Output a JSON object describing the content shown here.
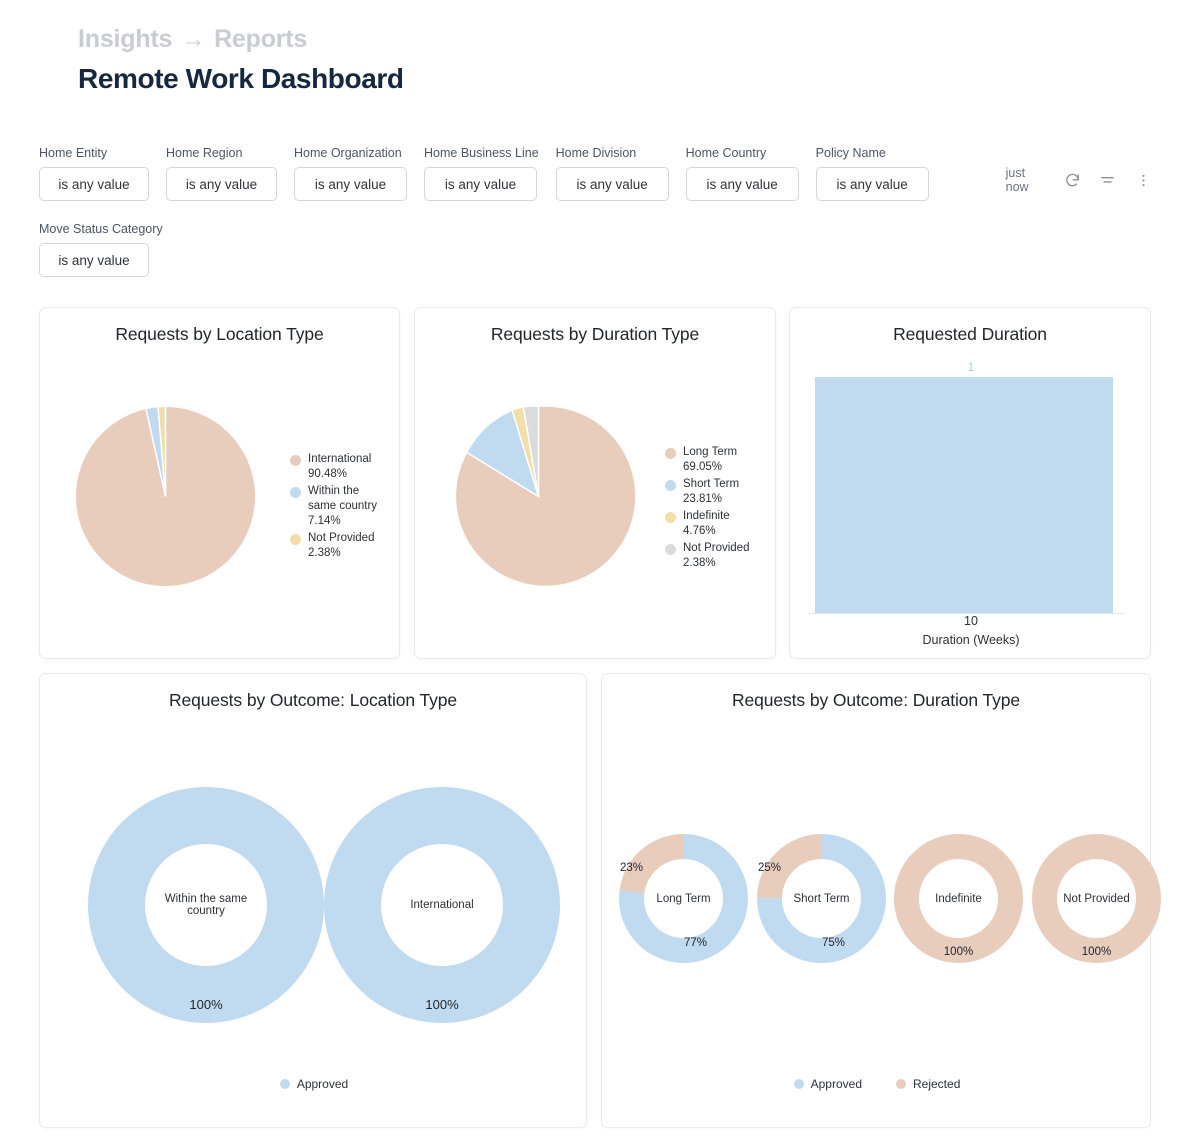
{
  "header": {
    "breadcrumb_parent": "Insights",
    "breadcrumb_arrow": "→",
    "breadcrumb_child": "Reports",
    "title": "Remote Work Dashboard"
  },
  "filters": {
    "value_text": "is any value",
    "items": [
      {
        "label": "Home Entity",
        "value": "is any value"
      },
      {
        "label": "Home Region",
        "value": "is any value"
      },
      {
        "label": "Home Organization",
        "value": "is any value"
      },
      {
        "label": "Home Business Line",
        "value": "is any value"
      },
      {
        "label": "Home Division",
        "value": "is any value"
      },
      {
        "label": "Home Country",
        "value": "is any value"
      },
      {
        "label": "Policy Name",
        "value": "is any value"
      },
      {
        "label": "Move Status Category",
        "value": "is any value"
      }
    ]
  },
  "toolbar": {
    "timestamp": "just now",
    "refresh_icon": "refresh-icon",
    "filter_icon": "filter-icon",
    "more_icon": "more-vertical-icon"
  },
  "colors": {
    "salmon": "#E8CCBC",
    "blue": "#C0DAF0",
    "yellow": "#F2DFA8",
    "gray": "#D9DCDA",
    "bar_blue": "#C0DAF0",
    "title_navy": "#16283f",
    "breadcrumb_gray": "#c9ccd0"
  },
  "chart_data": [
    {
      "type": "pie",
      "title": "Requests by Location Type",
      "categories": [
        "International",
        "Within the same country",
        "Not Provided"
      ],
      "values": [
        90.48,
        7.14,
        2.38
      ],
      "value_suffix": "%",
      "colors": [
        "#E8CCBC",
        "#C0DAF0",
        "#F2DFA8"
      ],
      "legend_position": "right",
      "legend": [
        {
          "label": "International",
          "value": "90.48%",
          "color": "#E8CCBC"
        },
        {
          "label": "Within the same country",
          "value": "7.14%",
          "color": "#C0DAF0"
        },
        {
          "label": "Not Provided",
          "value": "2.38%",
          "color": "#F2DFA8"
        }
      ]
    },
    {
      "type": "pie",
      "title": "Requests by Duration Type",
      "categories": [
        "Long Term",
        "Short Term",
        "Indefinite",
        "Not Provided"
      ],
      "values": [
        69.05,
        23.81,
        4.76,
        2.38
      ],
      "value_suffix": "%",
      "colors": [
        "#E8CCBC",
        "#C0DAF0",
        "#F2DFA8",
        "#D9DCDA"
      ],
      "legend_position": "right",
      "legend": [
        {
          "label": "Long Term",
          "value": "69.05%",
          "color": "#E8CCBC"
        },
        {
          "label": "Short Term",
          "value": "23.81%",
          "color": "#C0DAF0"
        },
        {
          "label": "Indefinite",
          "value": "4.76%",
          "color": "#F2DFA8"
        },
        {
          "label": "Not Provided",
          "value": "2.38%",
          "color": "#D9DCDA"
        }
      ]
    },
    {
      "type": "bar",
      "title": "Requested Duration",
      "categories": [
        "10"
      ],
      "values": [
        1
      ],
      "data_labels": [
        "1"
      ],
      "xlabel": "Duration (Weeks)",
      "ylabel": "",
      "ylim": [
        0,
        1
      ],
      "grid": false,
      "bar_color": "#C0DAF0"
    },
    {
      "type": "pie",
      "chart_style": "donut",
      "title": "Requests by Outcome: Location Type",
      "legend_position": "bottom",
      "legend": [
        {
          "label": "Approved",
          "color": "#C0DAF0"
        }
      ],
      "donuts": [
        {
          "label": "Within the same country",
          "segments": [
            {
              "name": "Approved",
              "value": 100,
              "display": "100%",
              "color": "#C0DAF0"
            }
          ]
        },
        {
          "label": "International",
          "segments": [
            {
              "name": "Approved",
              "value": 100,
              "display": "100%",
              "color": "#C0DAF0"
            }
          ]
        }
      ]
    },
    {
      "type": "pie",
      "chart_style": "donut",
      "title": "Requests by Outcome: Duration Type",
      "legend_position": "bottom",
      "legend": [
        {
          "label": "Approved",
          "color": "#C0DAF0"
        },
        {
          "label": "Rejected",
          "color": "#E8CCBC"
        }
      ],
      "donuts": [
        {
          "label": "Long Term",
          "segments": [
            {
              "name": "Approved",
              "value": 77,
              "display": "77%",
              "color": "#C0DAF0"
            },
            {
              "name": "Rejected",
              "value": 23,
              "display": "23%",
              "color": "#E8CCBC"
            }
          ]
        },
        {
          "label": "Short Term",
          "segments": [
            {
              "name": "Approved",
              "value": 75,
              "display": "75%",
              "color": "#C0DAF0"
            },
            {
              "name": "Rejected",
              "value": 25,
              "display": "25%",
              "color": "#E8CCBC"
            }
          ]
        },
        {
          "label": "Indefinite",
          "segments": [
            {
              "name": "Rejected",
              "value": 100,
              "display": "100%",
              "color": "#E8CCBC"
            }
          ]
        },
        {
          "label": "Not Provided",
          "segments": [
            {
              "name": "Rejected",
              "value": 100,
              "display": "100%",
              "color": "#E8CCBC"
            }
          ]
        }
      ]
    }
  ]
}
